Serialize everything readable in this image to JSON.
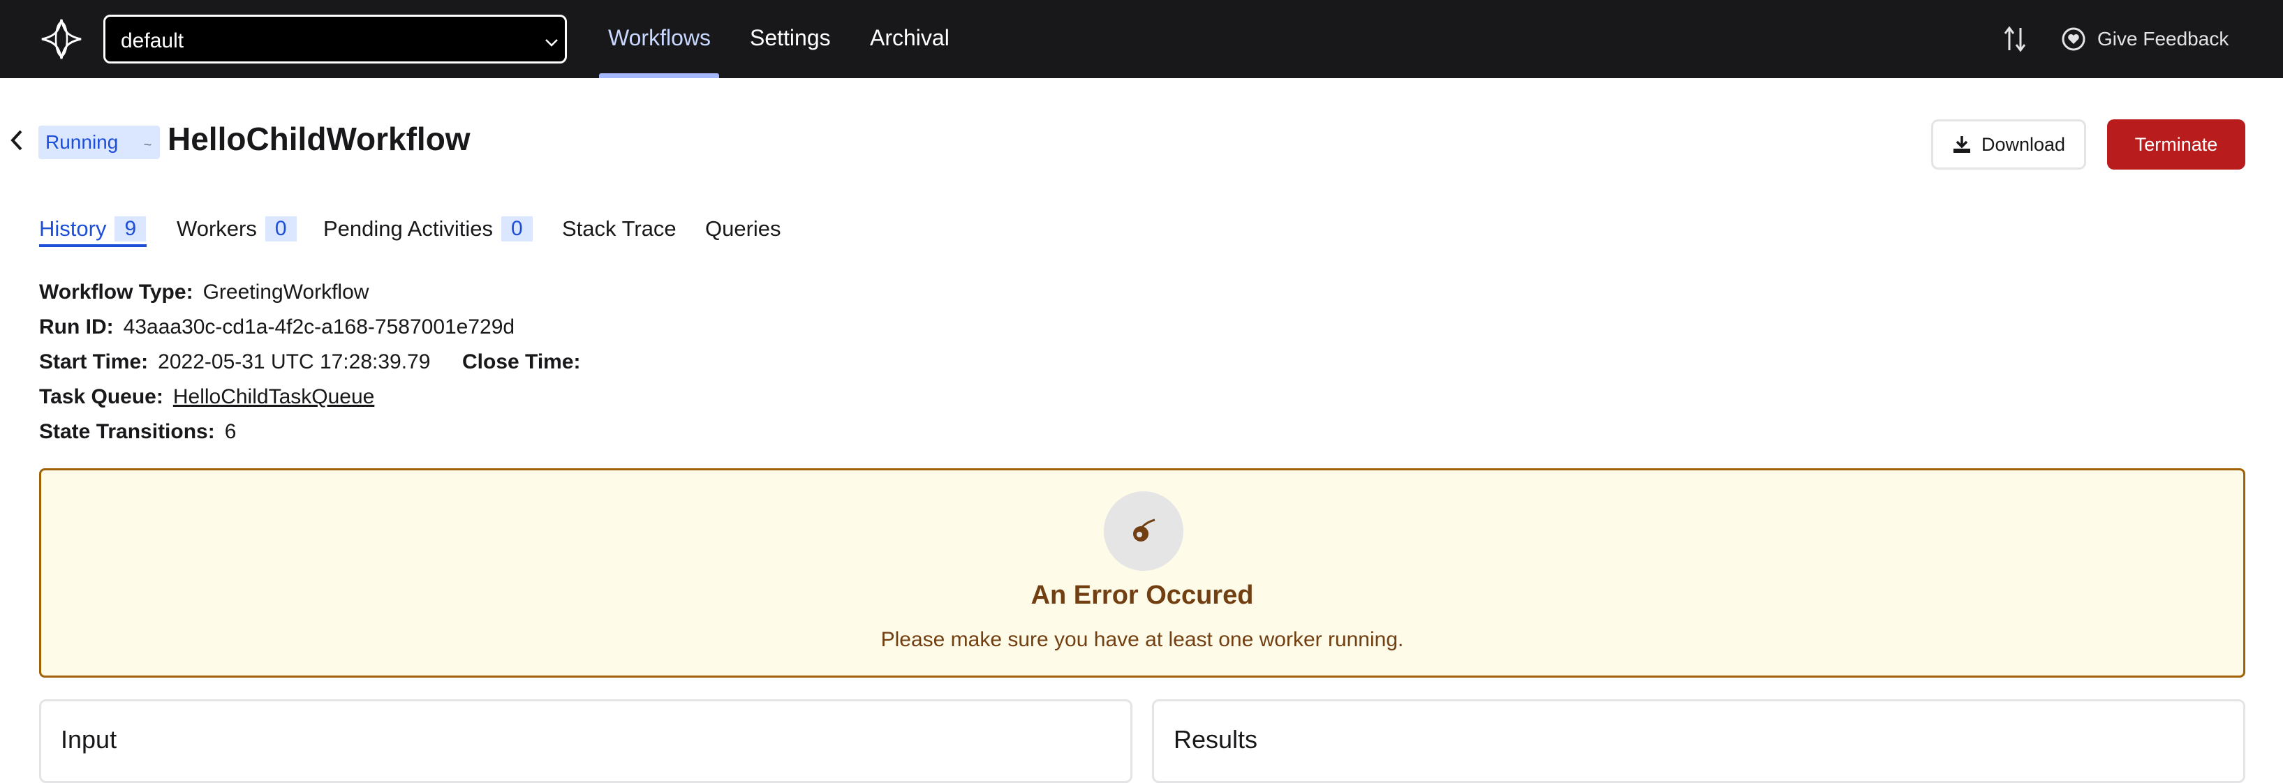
{
  "nav": {
    "namespace_value": "default",
    "links": [
      "Workflows",
      "Settings",
      "Archival"
    ],
    "feedback_label": "Give Feedback"
  },
  "header": {
    "status": "Running",
    "status_indicator": "~",
    "title": "HelloChildWorkflow",
    "download_label": "Download",
    "terminate_label": "Terminate"
  },
  "tabs": [
    {
      "label": "History",
      "count": "9"
    },
    {
      "label": "Workers",
      "count": "0"
    },
    {
      "label": "Pending Activities",
      "count": "0"
    },
    {
      "label": "Stack Trace"
    },
    {
      "label": "Queries"
    }
  ],
  "details": {
    "workflow_type": {
      "label": "Workflow Type:",
      "value": "GreetingWorkflow"
    },
    "run_id": {
      "label": "Run ID:",
      "value": "43aaa30c-cd1a-4f2c-a168-7587001e729d"
    },
    "start_time": {
      "label": "Start Time:",
      "value": "2022-05-31 UTC 17:28:39.79"
    },
    "close_time": {
      "label": "Close Time:"
    },
    "task_queue": {
      "label": "Task Queue:",
      "value": "HelloChildTaskQueue"
    },
    "state_transitions": {
      "label": "State Transitions:",
      "value": "6"
    }
  },
  "error": {
    "title": "An Error Occured",
    "message": "Please make sure you have at least one worker running."
  },
  "panels": {
    "input": "Input",
    "results": "Results"
  },
  "colors": {
    "nav_bg": "#18181b",
    "accent_blue": "#1d4ed8",
    "terminate_red": "#b91c1c",
    "error_border": "#a16207",
    "error_bg": "#fefbe9"
  },
  "icons": [
    "temporal-logo-icon",
    "chevron-down-icon",
    "sort-icon",
    "feedback-heart-icon",
    "chevron-left-icon",
    "download-icon",
    "comet-icon"
  ]
}
